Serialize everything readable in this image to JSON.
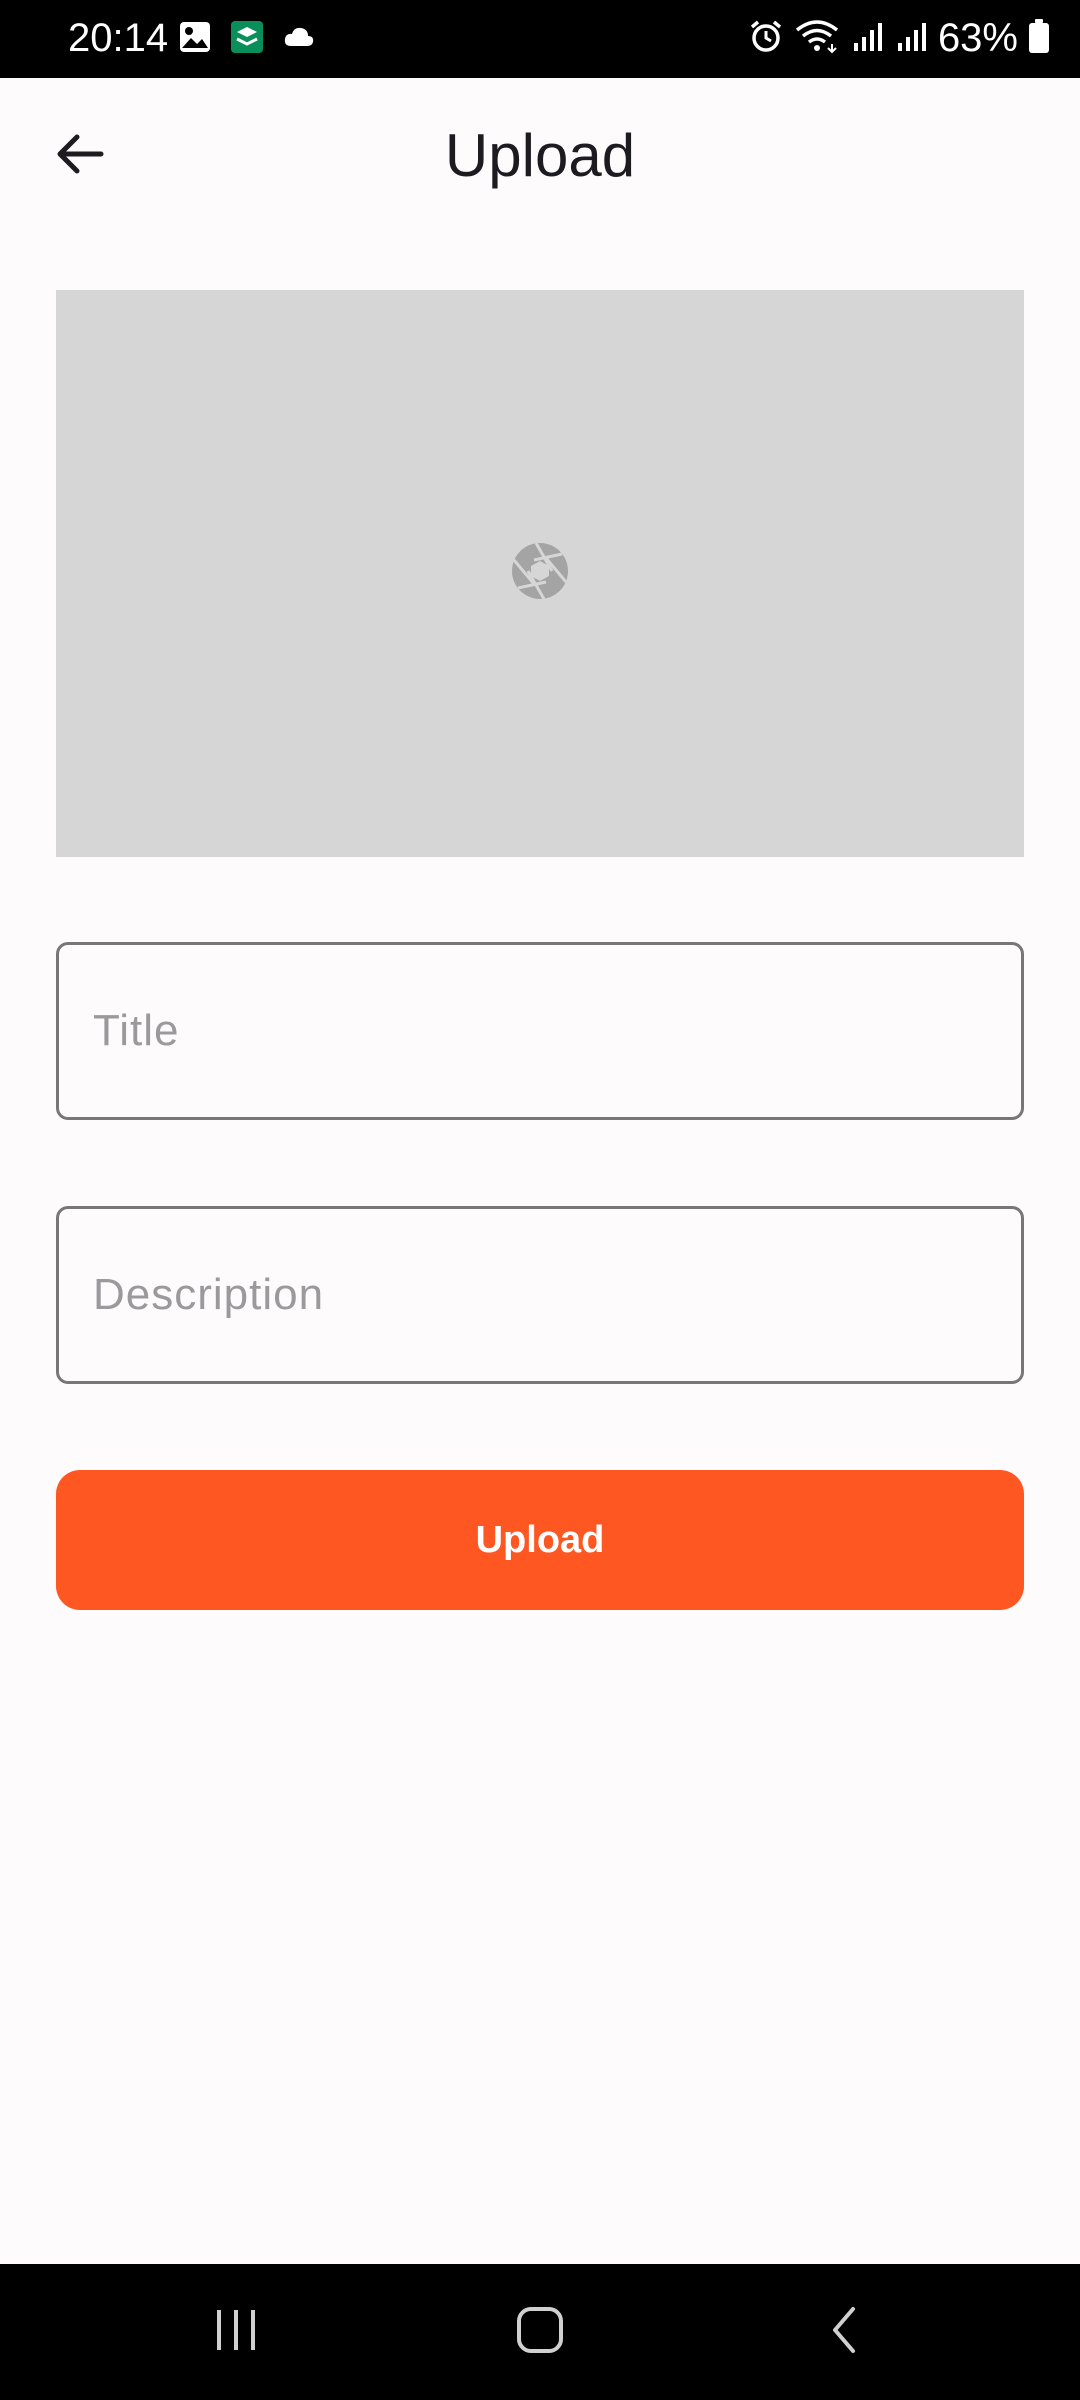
{
  "status_bar": {
    "time": "20:14",
    "battery": "63%",
    "left_icons": [
      "gallery-icon",
      "app-notification-icon",
      "cloud-icon"
    ],
    "right_icons": [
      "alarm-icon",
      "wifi-icon",
      "signal-icon",
      "signal-icon",
      "battery-icon"
    ]
  },
  "app_bar": {
    "title": "Upload",
    "back_icon": "arrow-left-icon"
  },
  "image_picker": {
    "icon": "camera-shutter-icon",
    "background": "#d6d6d6"
  },
  "form": {
    "title_placeholder": "Title",
    "title_value": "",
    "description_placeholder": "Description",
    "description_value": "",
    "submit_label": "Upload"
  },
  "nav_bar": {
    "buttons": [
      "recents-icon",
      "home-icon",
      "back-icon"
    ]
  },
  "colors": {
    "accent": "#ff5722",
    "background": "#fefbfd",
    "placeholder_box": "#d6d6d6",
    "field_border": "#7a7579"
  }
}
